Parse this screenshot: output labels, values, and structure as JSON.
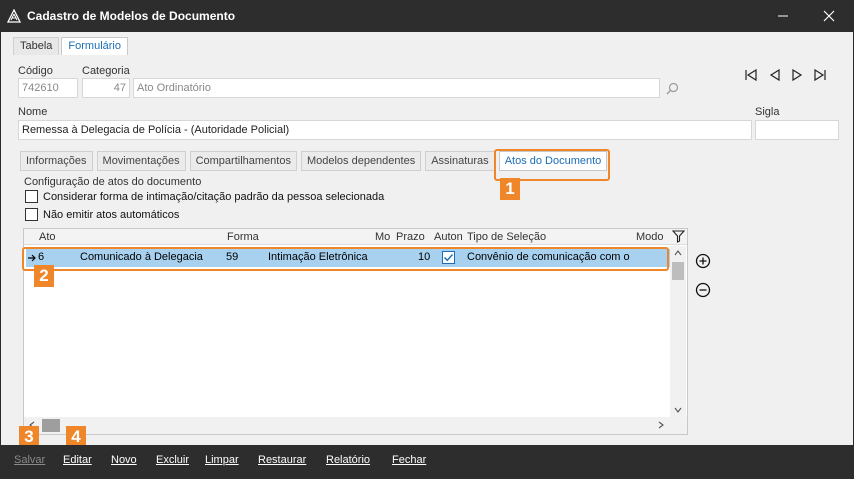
{
  "window": {
    "title": "Cadastro de Modelos de Documento"
  },
  "top_tabs": [
    "Tabela",
    "Formulário"
  ],
  "fields": {
    "codigo_label": "Código",
    "codigo_value": "742610",
    "categoria_label": "Categoria",
    "categoria_num": "47",
    "categoria_desc": "Ato Ordinatório",
    "nome_label": "Nome",
    "nome_value": "Remessa à Delegacia de Polícia - (Autoridade Policial)",
    "sigla_label": "Sigla",
    "sigla_value": ""
  },
  "sub_tabs": [
    "Informações",
    "Movimentações",
    "Compartilhamentos",
    "Modelos dependentes",
    "Assinaturas",
    "Atos do Documento"
  ],
  "config": {
    "section_label": "Configuração de atos do documento",
    "checkbox1": "Considerar forma de intimação/citação padrão da pessoa selecionada",
    "checkbox2": "Não emitir atos automáticos"
  },
  "grid": {
    "headers": [
      "Ato",
      "Forma",
      "Mo",
      "Prazo",
      "Auton",
      "Tipo de Seleção",
      "Modo"
    ],
    "row": {
      "ato_num": "6",
      "ato_desc": "Comunicado à Delegacia",
      "forma_num": "59",
      "forma_desc": "Intimação Eletrônica",
      "prazo": "10",
      "automatico": true,
      "tipo_selecao": "Convênio de comunicação com o"
    }
  },
  "callouts": [
    "1",
    "2",
    "3",
    "4"
  ],
  "toolbar": [
    "Salvar",
    "Editar",
    "Novo",
    "Excluir",
    "Limpar",
    "Restaurar",
    "Relatório",
    "Fechar"
  ],
  "colors": {
    "accent": "#f0862a",
    "selection": "#a8d1f0",
    "link_blue": "#1a6db8",
    "dark_bar": "#2d2d2d"
  }
}
